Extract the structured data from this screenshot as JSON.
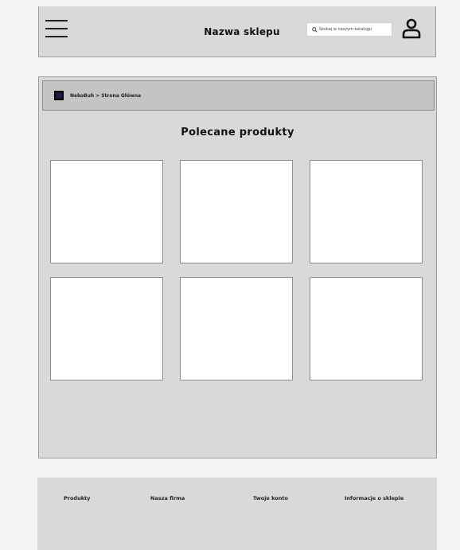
{
  "header": {
    "shop_name": "Nazwa sklepu",
    "search_placeholder": "Szukaj w naszym katalogu"
  },
  "breadcrumb": {
    "home": "NekoBuh",
    "separator": ">",
    "current": "Strona Główna"
  },
  "main": {
    "section_title": "Polecane produkty",
    "product_count": 6
  },
  "footer": {
    "links": [
      "Produkty",
      "Nasza firma",
      "Twoje konto",
      "Informacje o sklepie"
    ]
  }
}
